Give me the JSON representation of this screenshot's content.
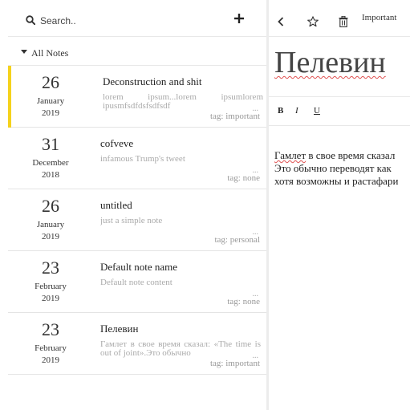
{
  "sidebar": {
    "search_label": "Search..",
    "add_icon": "plus-icon",
    "search_icon": "search-icon",
    "all_notes_label": "All Notes"
  },
  "notes": [
    {
      "day": "26",
      "month": "January",
      "year": "2019",
      "title": "Deconstruction and shit",
      "preview": "lorem ipsum...lorem ipsumlorem ipusmfsdfdsfsdfsdf",
      "tag": "tag: important",
      "active": true
    },
    {
      "day": "31",
      "month": "December",
      "year": "2018",
      "title": "cofveve",
      "preview": "infamous Trump's tweet",
      "tag": "tag: none",
      "active": false
    },
    {
      "day": "26",
      "month": "January",
      "year": "2019",
      "title": "untitled",
      "preview": "just a simple note",
      "tag": "tag: personal",
      "active": false
    },
    {
      "day": "23",
      "month": "February",
      "year": "2019",
      "title": "Default note name",
      "preview": "Default note content",
      "tag": "tag: none",
      "active": false
    },
    {
      "day": "23",
      "month": "February",
      "year": "2019",
      "title": "Пелевин",
      "preview": "Гамлет в свое время сказал: «The time is out of joint».Это обычно",
      "tag": "tag: important",
      "active": false
    }
  ],
  "ellipsis": "...",
  "editor": {
    "tag_label": "Important",
    "heading": "Пелевин",
    "format": {
      "bold": "B",
      "italic": "I",
      "underline": "U"
    },
    "body_lines": [
      {
        "spell": "Гамлет",
        "rest": " в свое время сказал"
      },
      {
        "spell": "",
        "rest": "Это обычно переводят как"
      },
      {
        "spell": "",
        "rest": "хотя возможны и растафари"
      }
    ]
  },
  "colors": {
    "active_accent": "#f5d21c",
    "spellcheck": "#e05050"
  }
}
